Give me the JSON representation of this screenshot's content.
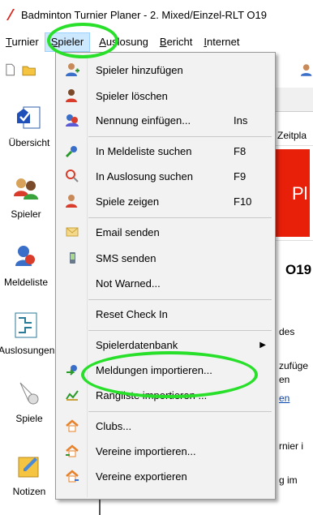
{
  "window": {
    "title": "Badminton Turnier Planer - 2. Mixed/Einzel-RLT O19"
  },
  "menubar": {
    "items": [
      {
        "label": "Turnier",
        "u": "T",
        "rest": "urnier"
      },
      {
        "label": "Spieler",
        "u": "S",
        "rest": "pieler"
      },
      {
        "label": "Auslosung",
        "u": "A",
        "rest": "uslosung"
      },
      {
        "label": "Bericht",
        "u": "B",
        "rest": "ericht"
      },
      {
        "label": "Internet",
        "u": "I",
        "rest": "nternet"
      }
    ]
  },
  "sidebar": {
    "items": [
      {
        "label": "Übersicht"
      },
      {
        "label": "Spieler"
      },
      {
        "label": "Meldeliste"
      },
      {
        "label": "Auslosungen"
      },
      {
        "label": "Spiele"
      },
      {
        "label": "Notizen"
      }
    ]
  },
  "content": {
    "tab_partial": "Zeitpla",
    "banner_partial": "Pl",
    "heading_partial": "O19",
    "lines": [
      "des",
      "zufüge",
      "en",
      "en",
      "rnier i",
      "g im"
    ]
  },
  "menu": {
    "items": [
      {
        "label": "Spieler hinzufügen",
        "shortcut": "",
        "icon": "add-player-icon"
      },
      {
        "label": "Spieler löschen",
        "shortcut": "",
        "icon": "delete-player-icon"
      },
      {
        "label": "Nennung einfügen...",
        "shortcut": "Ins",
        "icon": "insert-entry-icon"
      },
      {
        "label": "In Meldeliste suchen",
        "shortcut": "F8",
        "icon": "search-entries-icon"
      },
      {
        "label": "In Auslosung suchen",
        "shortcut": "F9",
        "icon": "search-draw-icon"
      },
      {
        "label": "Spiele zeigen",
        "shortcut": "F10",
        "icon": "show-matches-icon"
      },
      {
        "label": "Email senden",
        "shortcut": "",
        "icon": "email-icon"
      },
      {
        "label": "SMS senden",
        "shortcut": "",
        "icon": "sms-icon"
      },
      {
        "label": "Not Warned...",
        "shortcut": "",
        "icon": ""
      },
      {
        "label": "Reset Check In",
        "shortcut": "",
        "icon": ""
      },
      {
        "label": "Spielerdatenbank",
        "shortcut": "",
        "icon": "",
        "submenu": true
      },
      {
        "label": "Meldungen importieren...",
        "shortcut": "",
        "icon": "import-entries-icon"
      },
      {
        "label": "Rangliste importieren ...",
        "shortcut": "",
        "icon": "import-ranking-icon"
      },
      {
        "label": "Clubs...",
        "shortcut": "",
        "icon": "clubs-icon"
      },
      {
        "label": "Vereine importieren...",
        "shortcut": "",
        "icon": "import-clubs-icon"
      },
      {
        "label": "Vereine exportieren",
        "shortcut": "",
        "icon": "export-clubs-icon"
      }
    ]
  },
  "colors": {
    "annotation": "#28e02a",
    "highlight": "#cce8ff",
    "banner": "#e8200a"
  }
}
